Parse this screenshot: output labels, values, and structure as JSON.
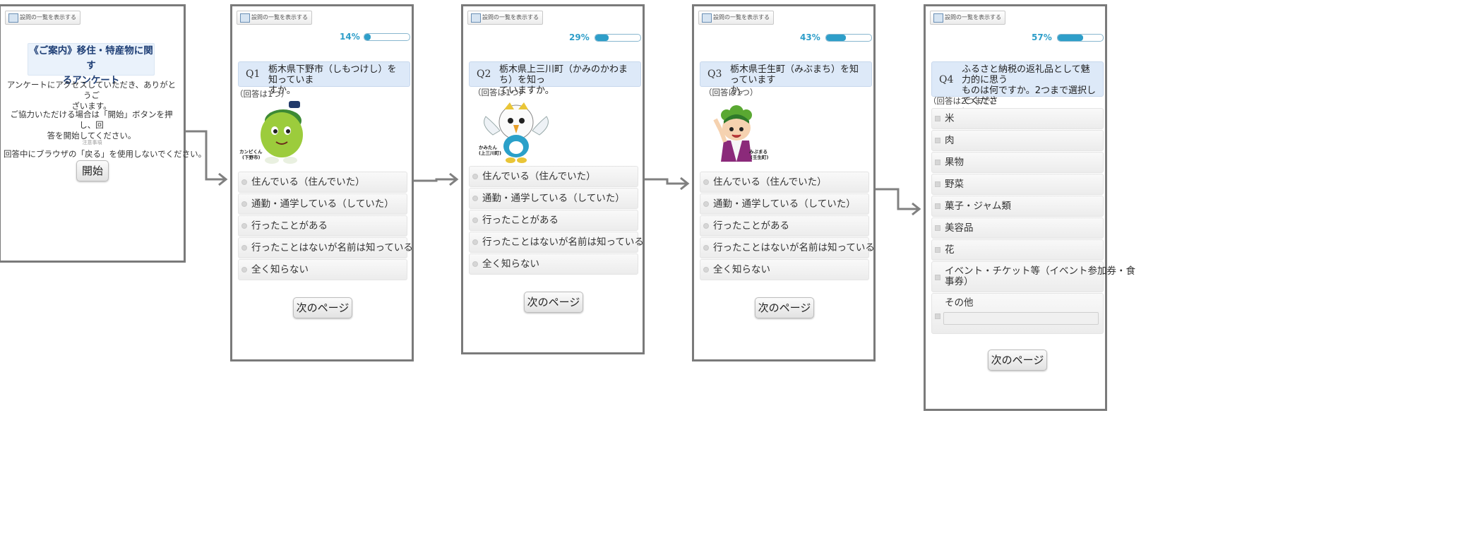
{
  "common": {
    "question_list_button": "設問の一覧を表示する",
    "next_button": "次のページ"
  },
  "intro": {
    "title": "《ご案内》移住・特産物に関するアンケート",
    "title_line1": "《ご案内》移住・特産物に関す",
    "title_line2": "るアンケート",
    "thanks_line1": "アンケートにアクセスしていただき、ありがとうご",
    "thanks_line2": "ざいます。",
    "instruction_line1": "ご協力いただける場合は「開始」ボタンを押し、回",
    "instruction_line2": "答を開始してください。",
    "notes_heading": "注意事項",
    "note": "回答中にブラウザの「戻る」を使用しないでください。",
    "start_button": "開始"
  },
  "screens": [
    {
      "progress_text": "14%",
      "progress_value": 0.14,
      "question_number": "Q1",
      "question_line1": "栃木県下野市（しもつけし）を知っていま",
      "question_line2": "すか。",
      "hint": "（回答は1つ）",
      "mascot_name": "カンピくん",
      "mascot_place": "(下野市)",
      "options": [
        "住んでいる（住んでいた）",
        "通勤・通学している（していた）",
        "行ったことがある",
        "行ったことはないが名前は知っている",
        "全く知らない"
      ]
    },
    {
      "progress_text": "29%",
      "progress_value": 0.29,
      "question_number": "Q2",
      "question_line1": "栃木県上三川町（かみのかわまち）を知っ",
      "question_line2": "ていますか。",
      "hint": "（回答は1つ）",
      "mascot_name": "かみたん",
      "mascot_place": "(上三川町)",
      "options": [
        "住んでいる（住んでいた）",
        "通勤・通学している（していた）",
        "行ったことがある",
        "行ったことはないが名前は知っている",
        "全く知らない"
      ]
    },
    {
      "progress_text": "43%",
      "progress_value": 0.43,
      "question_number": "Q3",
      "question_line1": "栃木県壬生町（みぶまち）を知っています",
      "question_line2": "か。",
      "hint": "（回答は1つ）",
      "mascot_name": "みぶまる",
      "mascot_place": "(壬生町)",
      "options": [
        "住んでいる（住んでいた）",
        "通勤・通学している（していた）",
        "行ったことがある",
        "行ったことはないが名前は知っている",
        "全く知らない"
      ]
    },
    {
      "progress_text": "57%",
      "progress_value": 0.57,
      "question_number": "Q4",
      "question_line1": "ふるさと納税の返礼品として魅力的に思う",
      "question_line2": "ものは何ですか。2つまで選択してくださ",
      "question_line3": "い。",
      "hint": "（回答は2つまで）",
      "options": [
        "米",
        "肉",
        "果物",
        "野菜",
        "菓子・ジャム類",
        "美容品",
        "花"
      ],
      "event_option_line1": "イベント・チケット等（イベント参加券・食",
      "event_option_line2": "事券）",
      "other_option": "その他",
      "other_input_value": ""
    }
  ],
  "colors": {
    "accent": "#2e9ec9",
    "question_header_bg": "#dde9f8",
    "frame_border": "#7a7a7a",
    "arrow": "#808080"
  },
  "icons": [
    "question-list-icon",
    "radio-icon",
    "checkbox-icon",
    "flow-arrow-icon"
  ]
}
